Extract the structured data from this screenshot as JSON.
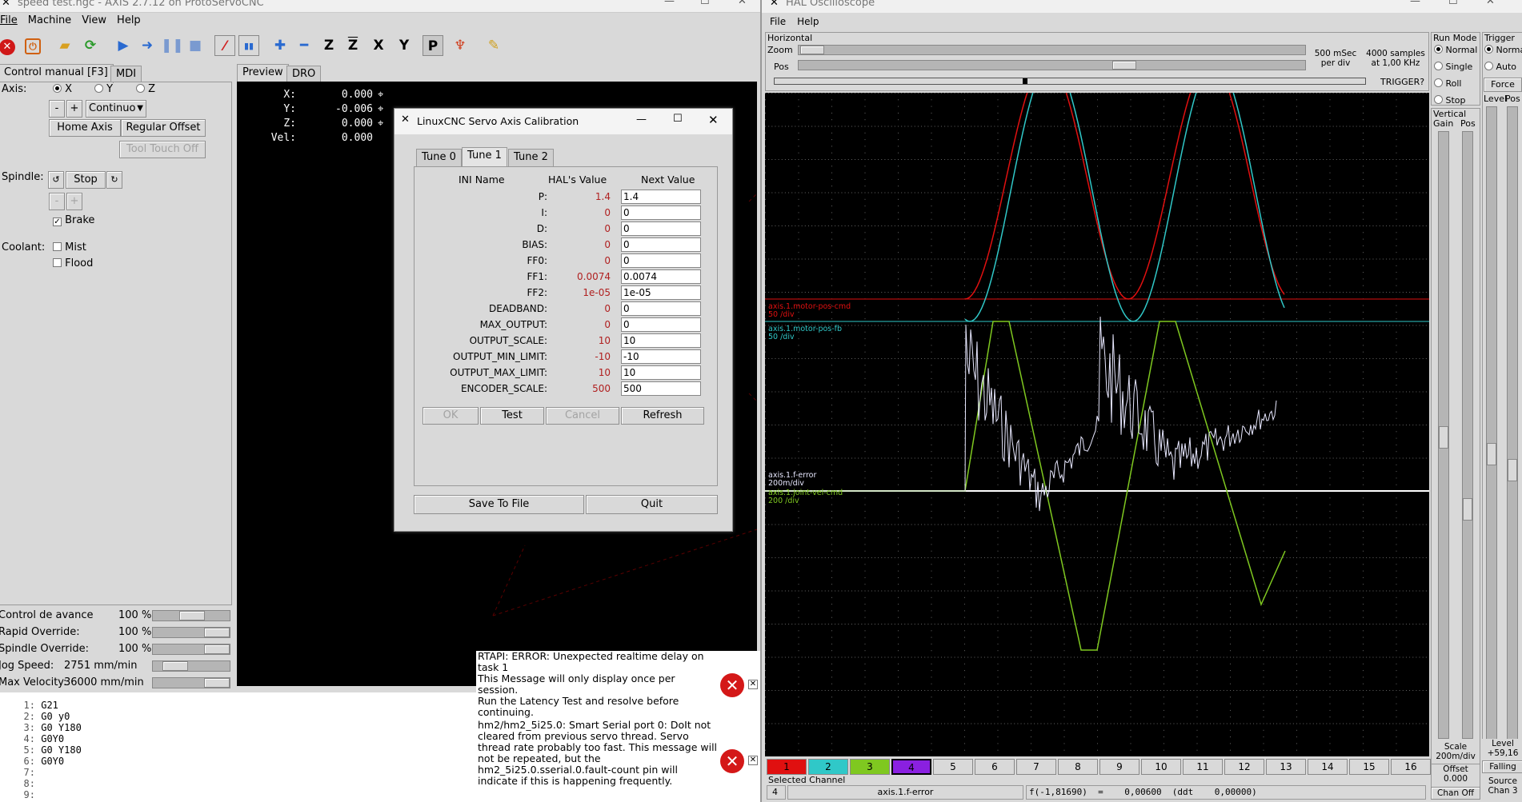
{
  "axis_win": {
    "title": "speed test.ngc - AXIS 2.7.12 on ProtoServoCNC",
    "menu": [
      "File",
      "Machine",
      "View",
      "Help"
    ],
    "toolbar_icons": [
      "estop-icon",
      "power-icon",
      "open-file-icon",
      "reload-icon",
      "run-icon",
      "step-icon",
      "pause-icon",
      "stop-icon",
      "block-delete-icon",
      "optional-stop-icon",
      "zoom-in-icon",
      "zoom-out-icon",
      "view-z-icon",
      "view-z2-icon",
      "view-x-icon",
      "view-y-icon",
      "view-p-icon",
      "rotate-icon",
      "clear-plot-icon"
    ],
    "toolbar_labels": [
      "Z",
      "Z",
      "X",
      "Y",
      "P"
    ],
    "tabs": [
      "Control manual [F3]",
      "MDI"
    ],
    "preview_tabs": [
      "Preview",
      "DRO"
    ],
    "axis_label": "Axis:",
    "axes": [
      "X",
      "Y",
      "Z"
    ],
    "minus": "-",
    "plus": "+",
    "jog_mode": "Continuo",
    "home_btn": "Home Axis",
    "offset_btn": "Regular Offset",
    "touch_btn": "Tool Touch Off",
    "spindle_label": "Spindle:",
    "stop_btn": "Stop",
    "brake": "Brake",
    "coolant_label": "Coolant:",
    "mist": "Mist",
    "flood": "Flood",
    "sliders": [
      {
        "label": "Control de avance",
        "value": "100 %",
        "fraction": 0.5
      },
      {
        "label": "Rapid Override:",
        "value": "100 %",
        "fraction": 1
      },
      {
        "label": "Spindle Override:",
        "value": "100 %",
        "fraction": 1
      },
      {
        "label": "Jog Speed:",
        "value": "2751 mm/min",
        "fraction": 0.2
      },
      {
        "label": "Max Velocity:",
        "value": "36000 mm/min",
        "fraction": 1
      }
    ],
    "dro": [
      {
        "axis": "X:",
        "value": "0.000"
      },
      {
        "axis": "Y:",
        "value": "-0.006"
      },
      {
        "axis": "Z:",
        "value": "0.000"
      },
      {
        "axis": "Vel:",
        "value": "0.000"
      }
    ],
    "gcode": [
      {
        "n": "1:",
        "t": "G21"
      },
      {
        "n": "2:",
        "t": "G0 y0"
      },
      {
        "n": "3:",
        "t": "G0 Y180"
      },
      {
        "n": "4:",
        "t": "G0Y0"
      },
      {
        "n": "5:",
        "t": "G0 Y180"
      },
      {
        "n": "6:",
        "t": "G0Y0"
      },
      {
        "n": "7:",
        "t": ""
      },
      {
        "n": "8:",
        "t": ""
      },
      {
        "n": "9:",
        "t": ""
      }
    ]
  },
  "errors": [
    {
      "text": "RTAPI: ERROR: Unexpected realtime delay on task 1\nThis Message will only display once per session.\nRun the Latency Test and resolve before continuing."
    },
    {
      "text": "hm2/hm2_5i25.0: Smart Serial port 0: DoIt not cleared from previous servo thread. Servo thread rate probably too fast. This message will not be repeated, but the hm2_5i25.0.sserial.0.fault-count pin will indicate if this is happening frequently."
    }
  ],
  "calib": {
    "title": "LinuxCNC Servo Axis Calibration",
    "tabs": [
      "Tune 0",
      "Tune 1",
      "Tune 2"
    ],
    "headers": [
      "INI Name",
      "HAL's Value",
      "Next Value"
    ],
    "rows": [
      [
        "P:",
        "1.4",
        "1.4"
      ],
      [
        "I:",
        "0",
        "0"
      ],
      [
        "D:",
        "0",
        "0"
      ],
      [
        "BIAS:",
        "0",
        "0"
      ],
      [
        "FF0:",
        "0",
        "0"
      ],
      [
        "FF1:",
        "0.0074",
        "0.0074"
      ],
      [
        "FF2:",
        "1e-05",
        "1e-05"
      ],
      [
        "DEADBAND:",
        "0",
        "0"
      ],
      [
        "MAX_OUTPUT:",
        "0",
        "0"
      ],
      [
        "OUTPUT_SCALE:",
        "10",
        "10"
      ],
      [
        "OUTPUT_MIN_LIMIT:",
        "-10",
        "-10"
      ],
      [
        "OUTPUT_MAX_LIMIT:",
        "10",
        "10"
      ],
      [
        "ENCODER_SCALE:",
        "500",
        "500"
      ]
    ],
    "buttons": [
      "OK",
      "Test",
      "Cancel",
      "Refresh"
    ],
    "save": "Save To File",
    "quit": "Quit"
  },
  "scope": {
    "title": "HAL Oscilloscope",
    "menu": [
      "File",
      "Help"
    ],
    "horizontal": "Horizontal",
    "zoom": "Zoom",
    "pos": "Pos",
    "rate": "500 mSec\nper div",
    "samples": "4000 samples\nat 1,00 KHz",
    "trigger_q": "TRIGGER?",
    "run_mode": "Run Mode",
    "modes": [
      "Normal",
      "Single",
      "Roll",
      "Stop"
    ],
    "trigger": "Trigger",
    "trig_modes": [
      "Normal",
      "Auto"
    ],
    "force": "Force",
    "level": "Level",
    "pos_col": "Pos",
    "vertical": "Vertical",
    "gain": "Gain",
    "vpos": "Pos",
    "traces": [
      {
        "name": "axis.1.motor-pos-cmd",
        "scale": "50 /div",
        "color": "#e01010"
      },
      {
        "name": "axis.1.motor-pos-fb",
        "scale": "50 /div",
        "color": "#30c8c8"
      },
      {
        "name": "axis.1.f-error",
        "scale": "200m/div",
        "color": "#e8e8ff"
      },
      {
        "name": "axis.1.joint-vel-cmd",
        "scale": "200 /div",
        "color": "#7fc820"
      }
    ],
    "channels": [
      "1",
      "2",
      "3",
      "4",
      "5",
      "6",
      "7",
      "8",
      "9",
      "10",
      "11",
      "12",
      "13",
      "14",
      "15",
      "16"
    ],
    "channel_colors": [
      "#e01010",
      "#30c8c8",
      "#7fc820",
      "#8a20e0"
    ],
    "selected_channel": "Selected Channel",
    "sel_num": "4",
    "sel_name": "axis.1.f-error",
    "readout": "f(-1,81690)  =    0,00600  (ddt    0,00000)",
    "scale_label": "Scale",
    "scale_val": "200m/div",
    "offset_label": "Offset",
    "offset_val": "0.000",
    "chan_off": "Chan Off",
    "level_label": "Level",
    "level_val": "+59,16",
    "falling": "Falling",
    "source": "Source",
    "source_val": "Chan 3"
  }
}
